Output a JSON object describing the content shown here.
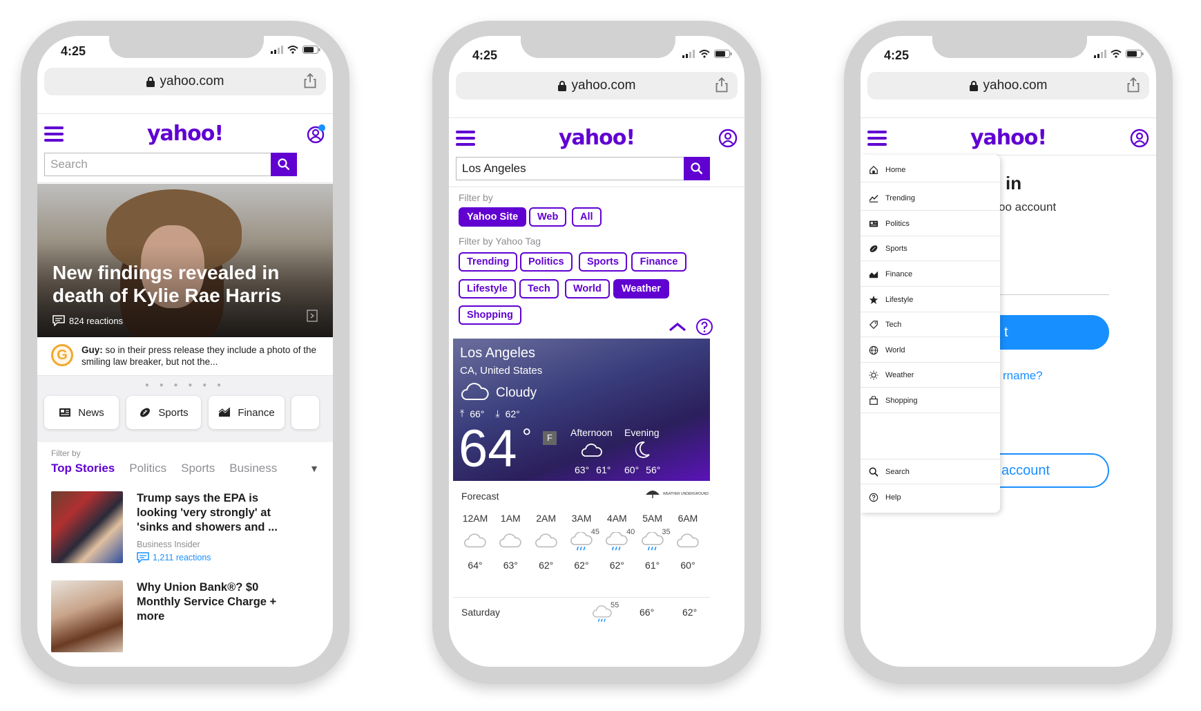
{
  "colors": {
    "brand": "#6001d2",
    "link": "#188fff"
  },
  "phones": [
    {
      "status_time": "4:25",
      "url": "yahoo.com",
      "logo": "yahoo!",
      "search_placeholder": "Search",
      "hero": {
        "headline": "New findings revealed in death of Kylie Rae Harris",
        "reactions": "824 reactions"
      },
      "comment": {
        "author": "Guy:",
        "text": "so in their press release they include a photo of the smiling law breaker, but not the..."
      },
      "categories": [
        {
          "label": "News",
          "icon": "newspaper-icon"
        },
        {
          "label": "Sports",
          "icon": "football-icon"
        },
        {
          "label": "Finance",
          "icon": "chart-icon"
        }
      ],
      "filter_label": "Filter by",
      "tabs": [
        "Top Stories",
        "Politics",
        "Sports",
        "Business"
      ],
      "stories": [
        {
          "title": "Trump says the EPA is looking 'very strongly' at 'sinks and showers and ...",
          "source": "Business Insider",
          "reactions": "1,211 reactions"
        },
        {
          "title": "Why Union Bank®? $0 Monthly Service Charge + more"
        }
      ]
    },
    {
      "status_time": "4:25",
      "url": "yahoo.com",
      "logo": "yahoo!",
      "search_value": "Los Angeles",
      "filter_by": "Filter by",
      "scope_chips": [
        "Yahoo Site",
        "Web",
        "All"
      ],
      "tag_label": "Filter by Yahoo Tag",
      "tag_chips": [
        "Trending",
        "Politics",
        "Sports",
        "Finance",
        "Lifestyle",
        "Tech",
        "World",
        "Weather",
        "Shopping"
      ],
      "weather": {
        "city": "Los Angeles",
        "region": "CA, United States",
        "condition": "Cloudy",
        "high": "66°",
        "low": "62°",
        "temp": "64",
        "unit": "F",
        "afternoon": {
          "label": "Afternoon",
          "hi": "63°",
          "lo": "61°"
        },
        "evening": {
          "label": "Evening",
          "hi": "60°",
          "lo": "56°"
        }
      },
      "forecast_label": "Forecast",
      "provider": "WEATHER UNDERGROUND",
      "hourly": [
        {
          "time": "12AM",
          "temp": "64°",
          "precip": ""
        },
        {
          "time": "1AM",
          "temp": "63°",
          "precip": ""
        },
        {
          "time": "2AM",
          "temp": "62°",
          "precip": ""
        },
        {
          "time": "3AM",
          "temp": "62°",
          "precip": "45"
        },
        {
          "time": "4AM",
          "temp": "62°",
          "precip": "40"
        },
        {
          "time": "5AM",
          "temp": "61°",
          "precip": "35"
        },
        {
          "time": "6AM",
          "temp": "60°",
          "precip": ""
        }
      ],
      "daily": {
        "day": "Saturday",
        "precip": "55",
        "hi": "66°",
        "lo": "62°"
      }
    },
    {
      "status_time": "4:25",
      "url": "yahoo.com",
      "logo": "yahoo!",
      "menu_items": [
        {
          "label": "Home",
          "icon": "home-icon"
        },
        {
          "label": "Trending",
          "icon": "trending-icon"
        },
        {
          "label": "Politics",
          "icon": "newspaper-icon"
        },
        {
          "label": "Sports",
          "icon": "football-icon"
        },
        {
          "label": "Finance",
          "icon": "chart-icon"
        },
        {
          "label": "Lifestyle",
          "icon": "star-icon"
        },
        {
          "label": "Tech",
          "icon": "tag-icon"
        },
        {
          "label": "World",
          "icon": "globe-icon"
        },
        {
          "label": "Weather",
          "icon": "sun-icon"
        },
        {
          "label": "Shopping",
          "icon": "bag-icon"
        }
      ],
      "menu_bottom": [
        {
          "label": "Search",
          "icon": "search-icon"
        },
        {
          "label": "Help",
          "icon": "help-icon"
        }
      ],
      "behind": {
        "title_fragment": "in",
        "subtitle_fragment": "oo account",
        "next_fragment": "t",
        "forgot_fragment": "rname?",
        "create_fragment": "account"
      }
    }
  ]
}
